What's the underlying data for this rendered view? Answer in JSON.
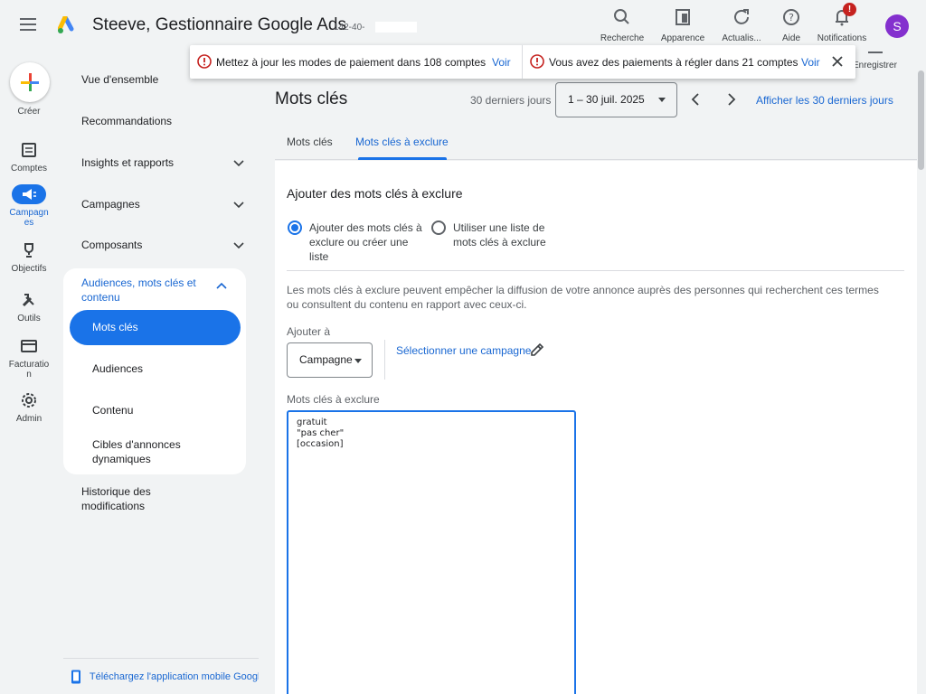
{
  "header": {
    "title": "Steeve, Gestionnaire Google Ads",
    "account_id": "142-40-",
    "tools": [
      {
        "label": "Recherche",
        "icon": "search-icon"
      },
      {
        "label": "Apparence",
        "icon": "appearance-icon"
      },
      {
        "label": "Actualis...",
        "icon": "refresh-icon"
      },
      {
        "label": "Aide",
        "icon": "help-icon"
      },
      {
        "label": "Notifications",
        "icon": "bell-icon"
      }
    ],
    "notification_badge": "!",
    "avatar_letter": "S",
    "save_label": "Enregistrer"
  },
  "rail": {
    "create_label": "Créer",
    "items": [
      {
        "label": "Comptes",
        "icon": "accounts-icon"
      },
      {
        "label": "Campagnes",
        "icon": "campaigns-icon"
      },
      {
        "label": "Objectifs",
        "icon": "trophy-icon"
      },
      {
        "label": "Outils",
        "icon": "tools-icon"
      },
      {
        "label": "Facturation",
        "icon": "billing-icon"
      },
      {
        "label": "Admin",
        "icon": "gear-icon"
      }
    ]
  },
  "nav": {
    "items": [
      {
        "label": "Vue d'ensemble"
      },
      {
        "label": "Recommandations"
      },
      {
        "label": "Insights et rapports"
      },
      {
        "label": "Campagnes"
      },
      {
        "label": "Composants"
      }
    ],
    "group_title": "Audiences, mots clés et contenu",
    "group_items": [
      {
        "label": "Mots clés"
      },
      {
        "label": "Audiences"
      },
      {
        "label": "Contenu"
      },
      {
        "label": "Cibles d'annonces dynamiques"
      }
    ],
    "history": "Historique des modifications",
    "footer": "Téléchargez l'application mobile Google Ads"
  },
  "banners": [
    {
      "text": "Mettez à jour les modes de paiement dans 108 comptes",
      "link": "Voir"
    },
    {
      "text": "Vous avez des paiements à régler dans 21 comptes",
      "link": "Voir"
    }
  ],
  "main": {
    "title": "Mots clés",
    "range_label": "30 derniers jours",
    "date_range": "1 – 30 juil. 2025",
    "show_last_30": "Afficher les 30 derniers jours",
    "tabs": [
      {
        "label": "Mots clés"
      },
      {
        "label": "Mots clés à exclure"
      }
    ],
    "card": {
      "title": "Ajouter des mots clés à exclure",
      "option_1": "Ajouter des mots clés à exclure ou créer une liste",
      "option_2": "Utiliser une liste de mots clés à exclure",
      "description": "Les mots clés à exclure peuvent empêcher la diffusion de votre annonce auprès des personnes qui recherchent ces termes ou consultent du contenu en rapport avec ceux-ci.",
      "add_to_label": "Ajouter à",
      "add_to_value": "Campagne",
      "select_campaign": "Sélectionner une campagne",
      "keywords_label": "Mots clés à exclure",
      "keywords_value": "gratuit\n\"pas cher\"\n[occasion]"
    }
  },
  "colors": {
    "accent": "#1a73e8",
    "link": "#1967d2",
    "error": "#c5221f",
    "avatar": "#8430ce"
  }
}
